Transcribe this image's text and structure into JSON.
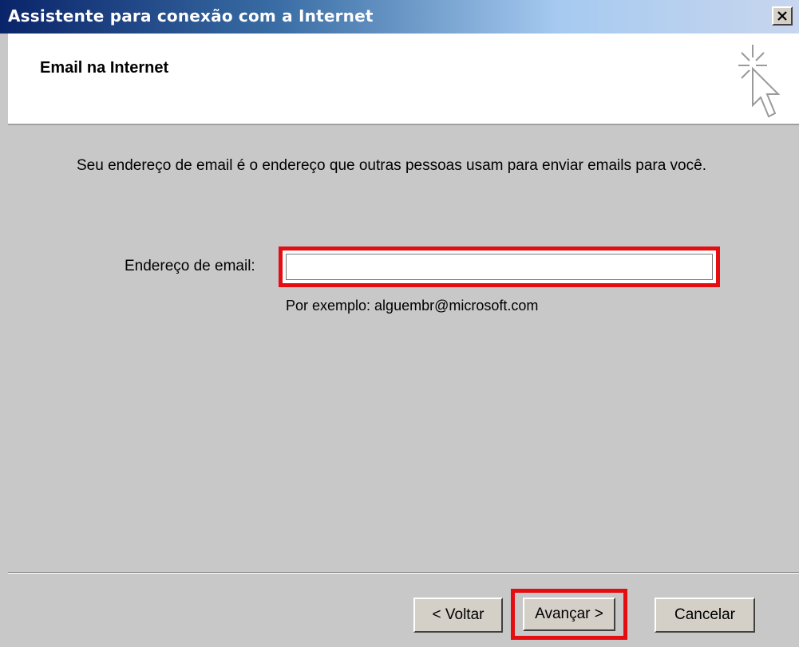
{
  "window": {
    "title": "Assistente para conexão com a Internet",
    "close_icon": "close-icon"
  },
  "header": {
    "title": "Email na Internet",
    "icon": "wizard-cursor-sparkle-icon"
  },
  "content": {
    "description": "Seu endereço de email é o endereço que outras pessoas usam para enviar emails para você.",
    "email_label": "Endereço de email:",
    "email_value": "",
    "example": "Por exemplo: alguembr@microsoft.com"
  },
  "buttons": {
    "back": "< Voltar",
    "next": "Avançar >",
    "cancel": "Cancelar"
  },
  "colors": {
    "highlight": "#e30d12",
    "dialog_bg": "#c8c8c8",
    "titlebar_start": "#0a246a"
  }
}
